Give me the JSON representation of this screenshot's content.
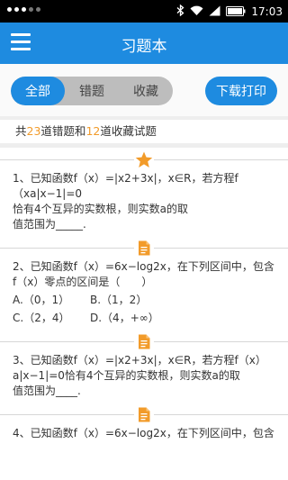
{
  "statusbar": {
    "time": "17:03"
  },
  "appbar": {
    "title": "习题本"
  },
  "tabs": [
    {
      "label": "全部",
      "active": true
    },
    {
      "label": "错题",
      "active": false
    },
    {
      "label": "收藏",
      "active": false
    }
  ],
  "download_button": "下载打印",
  "summary": {
    "prefix": "共",
    "wrong_count": "23",
    "middle": "道错题和",
    "fav_count": "12",
    "suffix": "道收藏试题"
  },
  "colors": {
    "primary": "#1e8be0",
    "accent": "#f29b2a"
  },
  "questions": [
    {
      "marker": "star-icon",
      "lines": [
        "1、已知函数f（x）=|x2+3x|，x∈R，若方程f（xa|x−1|=0",
        "恰有4个互异的实数根，则实数a的取",
        "值范围为_____."
      ]
    },
    {
      "marker": "document-icon",
      "lines": [
        "2、已知函数f（x）=6x−log2x，在下列区间中，包含",
        "f（x）零点的区间是（　　）"
      ],
      "options": [
        "A.（0，1）",
        "B.（1，2）",
        "C.（2，4）",
        "D.（4，+∞）"
      ]
    },
    {
      "marker": "document-icon",
      "lines": [
        "3、已知函数f（x）=|x2+3x|，x∈R，若方程f（x）",
        "a|x−1|=0恰有4个互异的实数根，则实数a的取",
        "值范围为____."
      ]
    },
    {
      "marker": "document-icon",
      "lines": [
        "4、已知函数f（x）=6x−log2x，在下列区间中，包含"
      ]
    }
  ]
}
